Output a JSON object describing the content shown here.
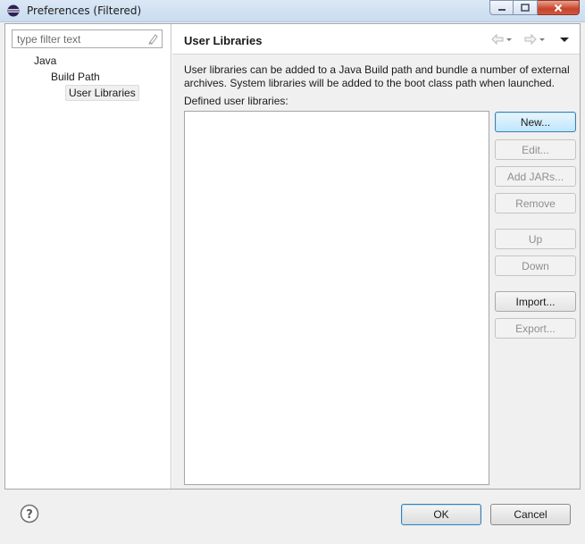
{
  "window": {
    "title": "Preferences (Filtered)"
  },
  "filter": {
    "placeholder": "type filter text"
  },
  "tree": {
    "items": [
      {
        "label": "Java"
      },
      {
        "label": "Build Path"
      },
      {
        "label": "User Libraries"
      }
    ]
  },
  "page": {
    "title": "User Libraries",
    "description": "User libraries can be added to a Java Build path and bundle a number of external archives. System libraries will be added to the boot class path when launched.",
    "list_label": "Defined user libraries:"
  },
  "buttons": {
    "new": "New...",
    "edit": "Edit...",
    "add_jars": "Add JARs...",
    "remove": "Remove",
    "up": "Up",
    "down": "Down",
    "import": "Import...",
    "export": "Export..."
  },
  "footer": {
    "ok": "OK",
    "cancel": "Cancel"
  },
  "icons": {
    "app": "eclipse-icon",
    "clear": "clear-filter-icon",
    "back": "back-arrow-icon",
    "forward": "forward-arrow-icon",
    "menu": "view-menu-icon",
    "help": "help-icon"
  },
  "colors": {
    "focus_border": "#3c7fb1",
    "close_button": "#c7432b"
  }
}
